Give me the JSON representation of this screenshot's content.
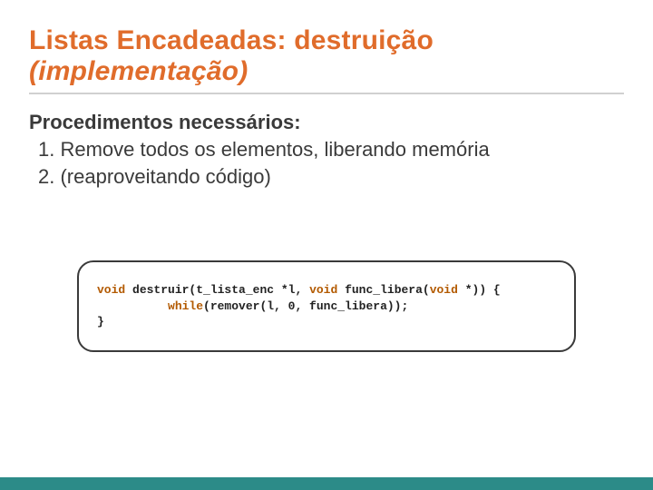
{
  "title_main": "Listas Encadeadas: destruição ",
  "title_impl": "(implementação)",
  "subheading": "Procedimentos necessários:",
  "items": [
    "1. Remove todos os elementos, liberando memória",
    "2. (reaproveitando código)"
  ],
  "code": {
    "kw_void1": "void",
    "fn": " destruir(t_lista_enc *l, ",
    "kw_void2": "void",
    "mid": " func_libera(",
    "kw_void3": "void",
    "after": " *)) {",
    "line2_indent": "          ",
    "kw_while": "while",
    "line2_rest": "(remover(l, 0, func_libera));",
    "line3": "}"
  },
  "colors": {
    "accent": "#E06C2B",
    "footer": "#2C8B88",
    "keyword": "#b35a00"
  }
}
